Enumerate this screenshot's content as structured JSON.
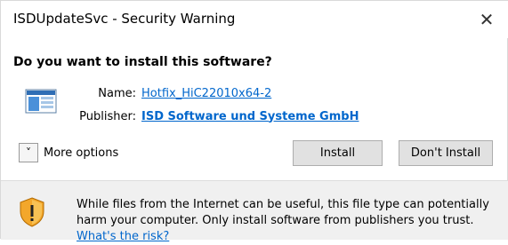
{
  "window": {
    "title": "ISDUpdateSvc - Security Warning",
    "close_symbol": "✕"
  },
  "main": {
    "question": "Do you want to install this software?",
    "name_label": "Name:",
    "name_value": "Hotfix_HiC22010x64-2",
    "publisher_label": "Publisher:",
    "publisher_value": "ISD Software und Systeme GmbH",
    "more_options_label": "More options",
    "expand_symbol": "˅"
  },
  "buttons": {
    "install": "Install",
    "dont_install": "Don't Install"
  },
  "footer": {
    "warning_text": "While files from the Internet can be useful, this file type can potentially harm your computer. Only install software from publishers you trust.",
    "risk_link": "What's the risk?"
  },
  "colors": {
    "link": "#0066cc",
    "footer_bg": "#f0f0f0",
    "button_bg": "#e1e1e1"
  },
  "icons": {
    "app": "installer-window-icon",
    "warning": "shield-warning-icon",
    "close": "close-icon",
    "expand": "chevron-down-icon"
  }
}
